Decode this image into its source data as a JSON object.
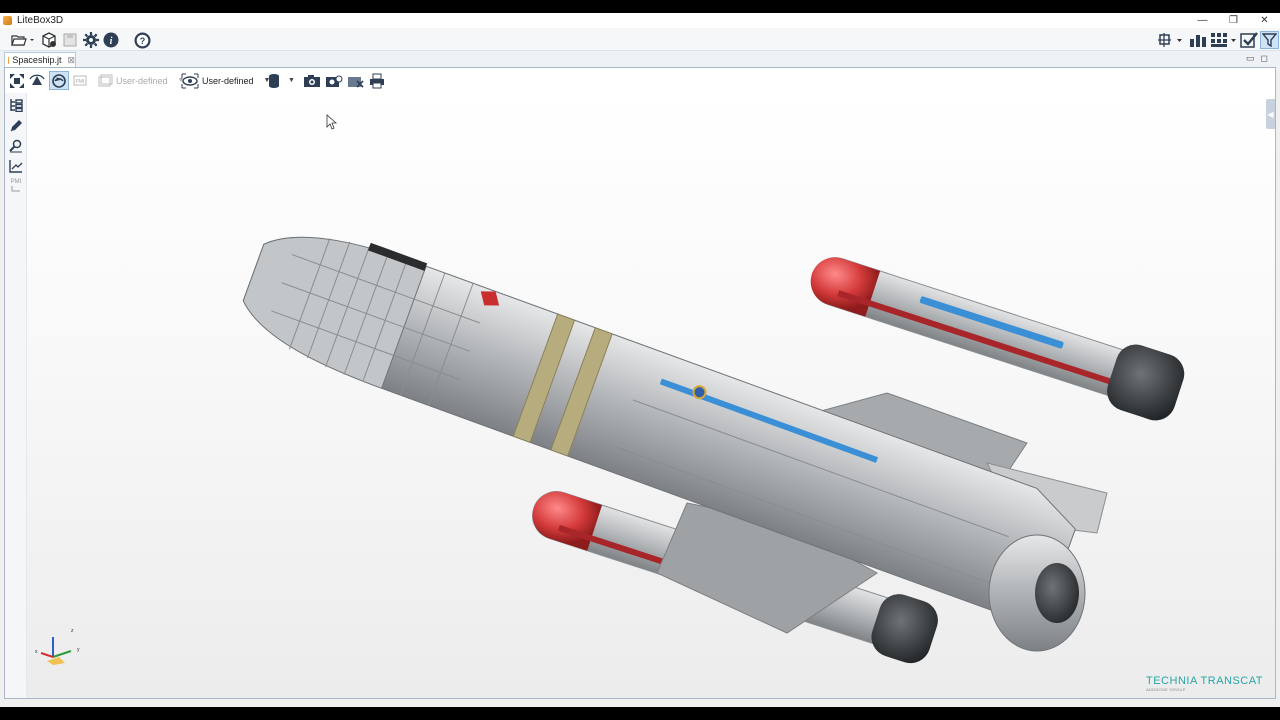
{
  "window": {
    "title": "LiteBox3D",
    "controls": {
      "minimize": "—",
      "restore": "❐",
      "close": "✕"
    }
  },
  "main_toolbar": {
    "icons": [
      "open-folder-icon",
      "package-icon",
      "save-icon",
      "settings-gear-icon",
      "info-icon",
      "help-icon"
    ],
    "right_icons": [
      "layout-options-icon",
      "bar-chart-icon",
      "grid-view-icon",
      "checkmark-icon",
      "filter-icon"
    ]
  },
  "tabs": [
    {
      "label": "Spaceship.jt",
      "close": "⊠"
    }
  ],
  "view_controls": {
    "minimize": "▭",
    "maximize": "◻"
  },
  "viewer_toolbar": {
    "pmi_label": "PMI",
    "view_select_disabled": "User-defined",
    "view_select": "User-defined"
  },
  "side_toolbar": {
    "items": [
      "structure-tree-icon",
      "pen-icon",
      "search-icon",
      "measure-icon",
      "pmi-icon"
    ],
    "pmi_label": "PMI"
  },
  "scene": {
    "model": "spaceship-model",
    "triad": {
      "x": "x",
      "y": "y",
      "z": "z"
    }
  },
  "brand": {
    "name": "TECHNIA TRANSCAT",
    "sub": "ADDNODE GROUP"
  },
  "colors": {
    "accent": "#2aa6a6",
    "hull": "#b9bcbf",
    "nose": "#d9393a",
    "stripe": "#3b8fd6"
  }
}
